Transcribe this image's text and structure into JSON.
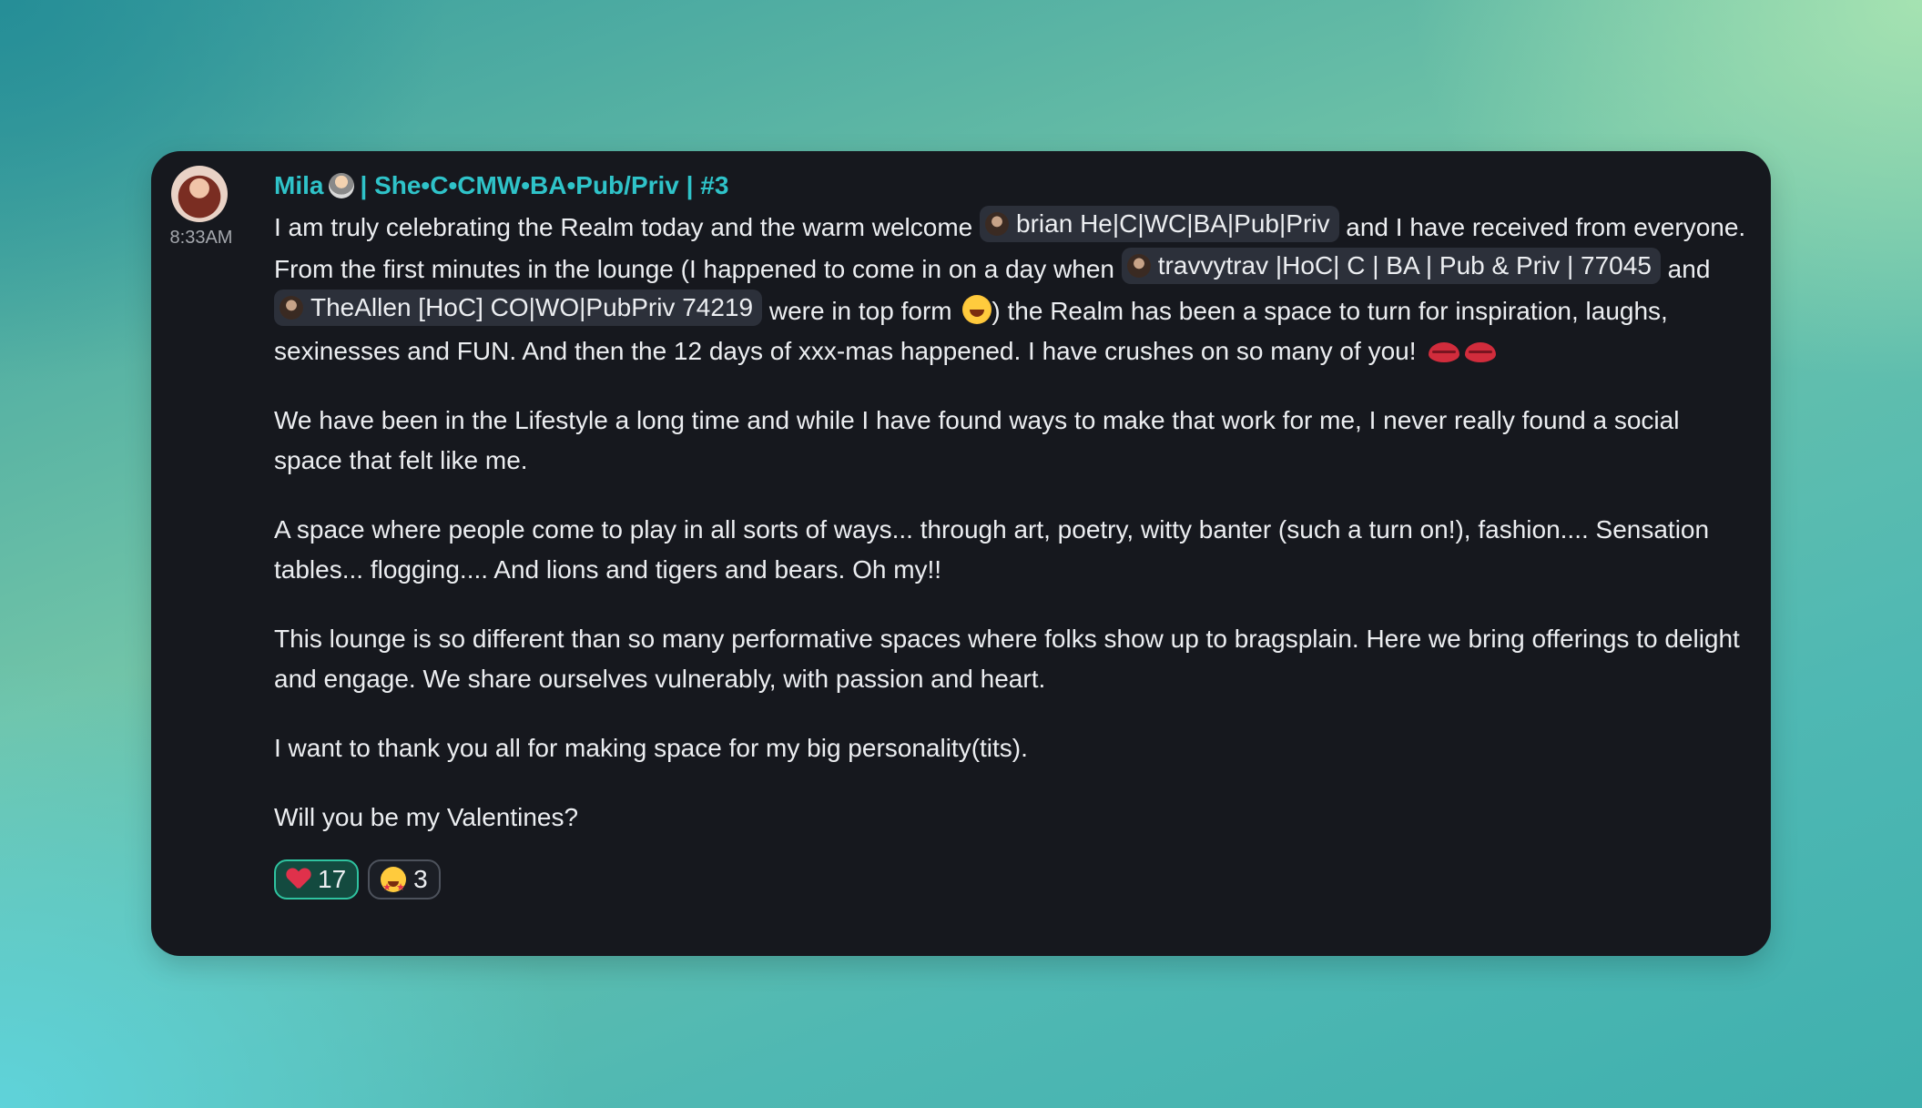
{
  "message": {
    "author": "Mila",
    "author_suffix": "| She•C•CMW•BA•Pub/Priv | #3",
    "timestamp": "8:33AM",
    "p1_a": "I am truly celebrating the Realm today and the warm welcome ",
    "mention_brian": "brian He|C|WC|BA|Pub|Priv",
    "p1_b": " and I have received from everyone. From the first minutes in the lounge (I happened to come in on a day when ",
    "mention_travvy": "travvytrav |HoC| C | BA | Pub & Priv | 77045",
    "p1_c": " and ",
    "mention_allen": "TheAllen [HoC] CO|WO|PubPriv 74219",
    "p1_d": " were in top form ",
    "p1_e": ") the Realm has been a space to turn for inspiration, laughs, sexinesses and FUN. And then the 12 days of xxx-mas happened. I have crushes on so many of you! ",
    "p2": "We have been in the Lifestyle a long time and while I have found ways to make that work for me, I never really found a social space that felt like me.",
    "p3": "A space where people come to play in all sorts of ways... through art, poetry, witty banter (such a turn on!), fashion.... Sensation tables... flogging.... And lions and tigers and bears. Oh my!!",
    "p4": "This lounge is so different than so many performative spaces where folks show up to bragsplain. Here we bring offerings to delight and engage. We share ourselves vulnerably, with passion and heart.",
    "p5": "I want to thank you all for making space for my big personality(tits).",
    "p6": "Will you be my Valentines?"
  },
  "reactions": [
    {
      "icon": "heart-icon",
      "count": "17",
      "active": true
    },
    {
      "icon": "star-struck-icon",
      "count": "3",
      "active": false
    }
  ],
  "colors": {
    "accent": "#2fc3c9",
    "card_bg": "#16181e",
    "mention_bg": "#2c303a",
    "active_reaction_border": "#2fc3a0"
  }
}
